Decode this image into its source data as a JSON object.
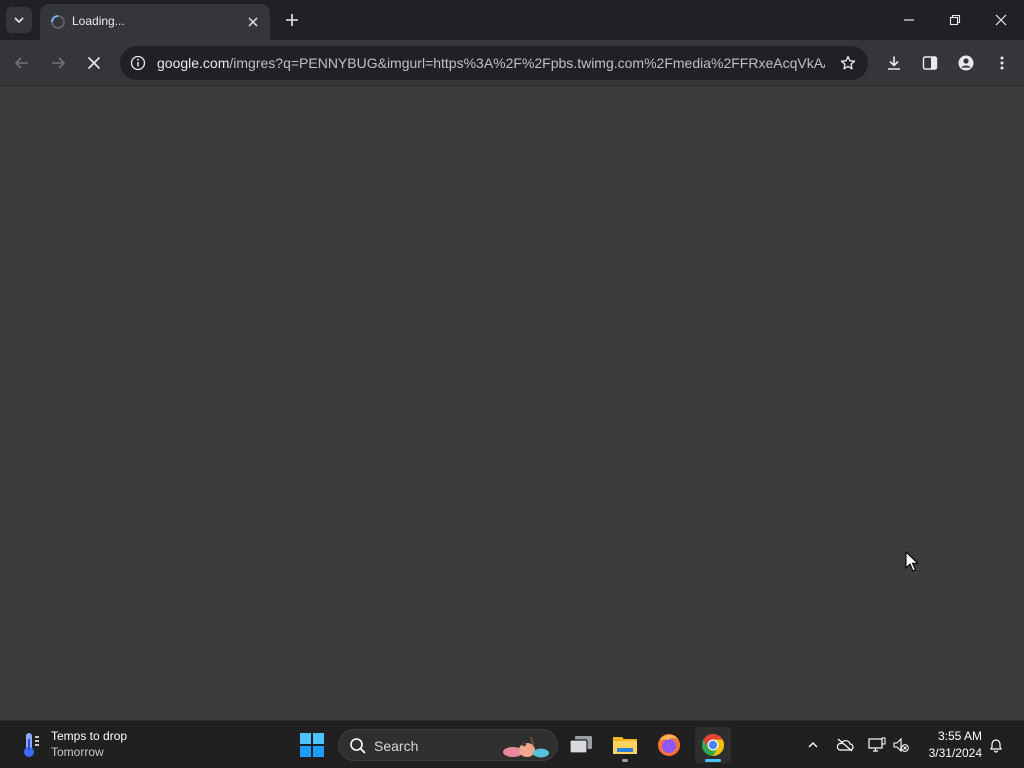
{
  "browser": {
    "tab": {
      "title": "Loading..."
    },
    "address_bar": {
      "url_host": "google.com",
      "url_rest": "/imgres?q=PENNYBUG&imgurl=https%3A%2F%2Fpbs.twimg.com%2Fmedia%2FFRxeAcqVkAA..."
    }
  },
  "taskbar": {
    "weather": {
      "title": "Temps to drop",
      "subtitle": "Tomorrow"
    },
    "search": {
      "placeholder": "Search"
    },
    "apps": [
      "task-view",
      "file-explorer",
      "firefox",
      "chrome"
    ],
    "clock": {
      "time": "3:55 AM",
      "date": "3/31/2024"
    }
  },
  "colors": {
    "tabstrip": "#202124",
    "toolbar": "#35363a",
    "content": "#3c3c3c",
    "taskbar": "#202020",
    "accent": "#8ab4f8"
  }
}
